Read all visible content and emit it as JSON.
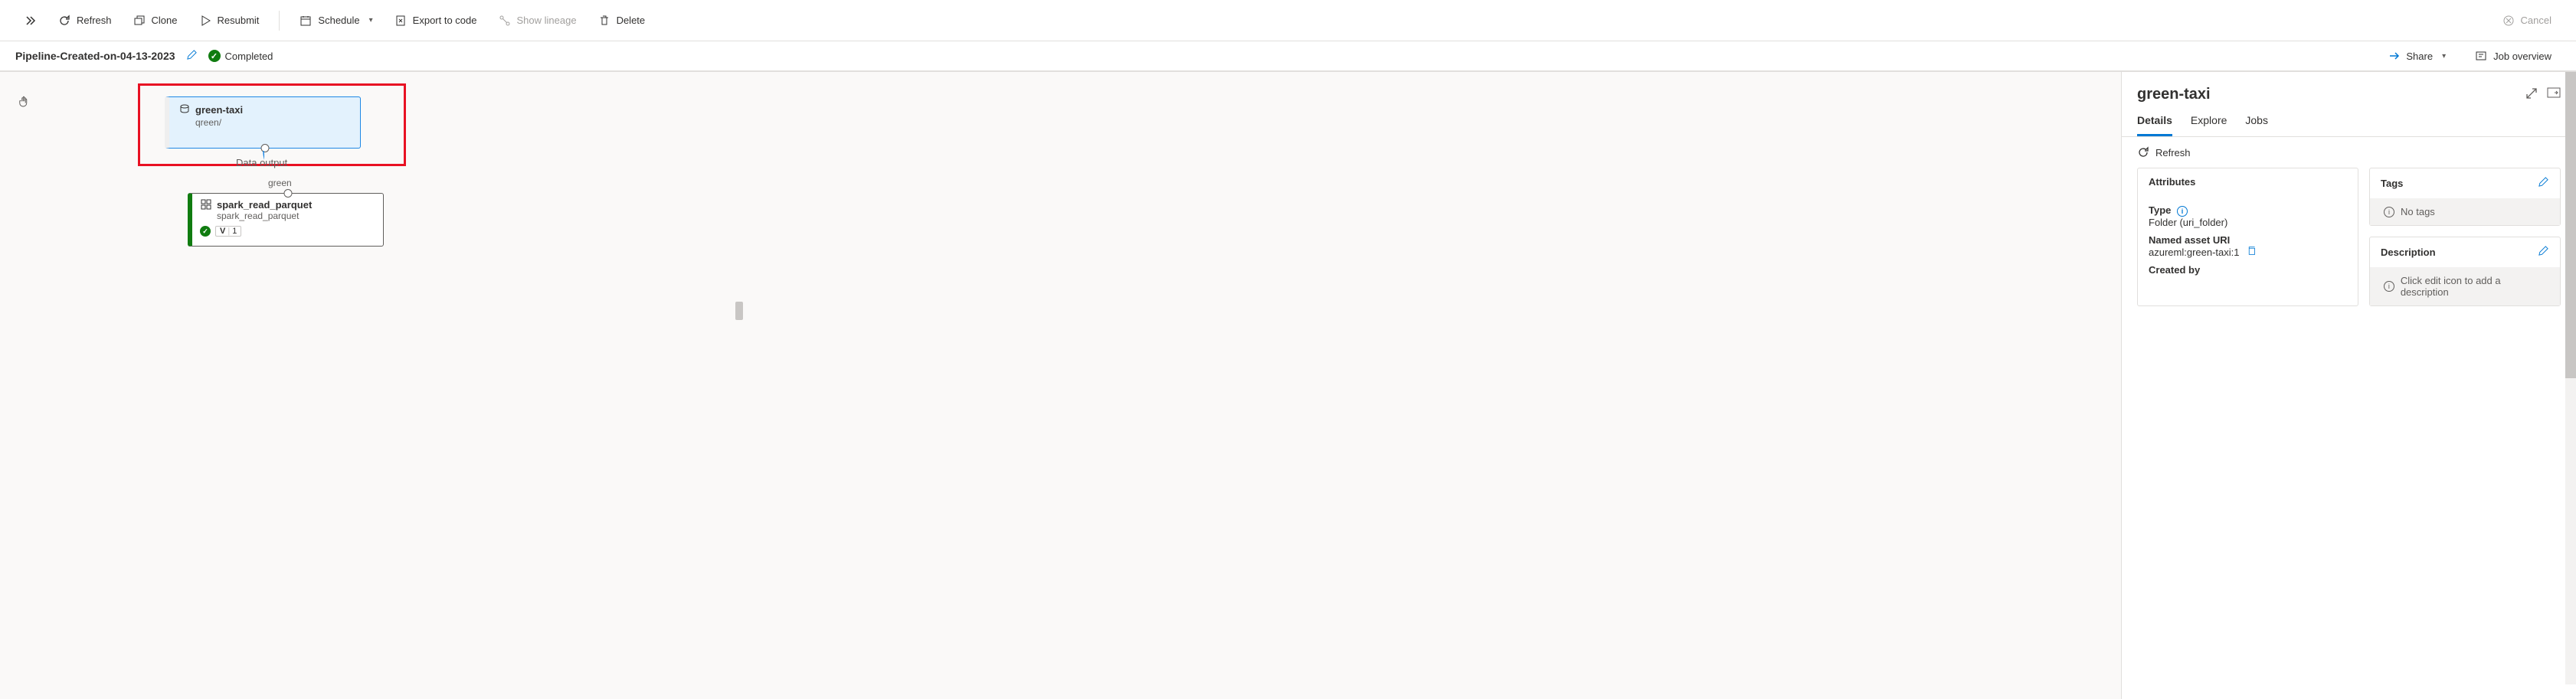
{
  "toolbar": {
    "refresh": "Refresh",
    "clone": "Clone",
    "resubmit": "Resubmit",
    "schedule": "Schedule",
    "export": "Export to code",
    "lineage": "Show lineage",
    "delete": "Delete",
    "cancel": "Cancel"
  },
  "pipeline": {
    "name": "Pipeline-Created-on-04-13-2023",
    "status": "Completed",
    "share": "Share",
    "overview": "Job overview"
  },
  "canvas": {
    "node1": {
      "title": "green-taxi",
      "subtitle": "qreen/",
      "portLabel": "Data output"
    },
    "edge": {
      "label": "green"
    },
    "node2": {
      "title": "spark_read_parquet",
      "subtitle": "spark_read_parquet",
      "version_prefix": "V",
      "version_num": "1"
    }
  },
  "panel": {
    "title": "green-taxi",
    "tabs": {
      "details": "Details",
      "explore": "Explore",
      "jobs": "Jobs"
    },
    "refresh": "Refresh",
    "attributes": {
      "heading": "Attributes",
      "type_label": "Type",
      "type_value": "Folder (uri_folder)",
      "uri_label": "Named asset URI",
      "uri_value": "azureml:green-taxi:1",
      "created_label": "Created by"
    },
    "tags": {
      "heading": "Tags",
      "empty": "No tags"
    },
    "description": {
      "heading": "Description",
      "empty": "Click edit icon to add a description"
    }
  }
}
